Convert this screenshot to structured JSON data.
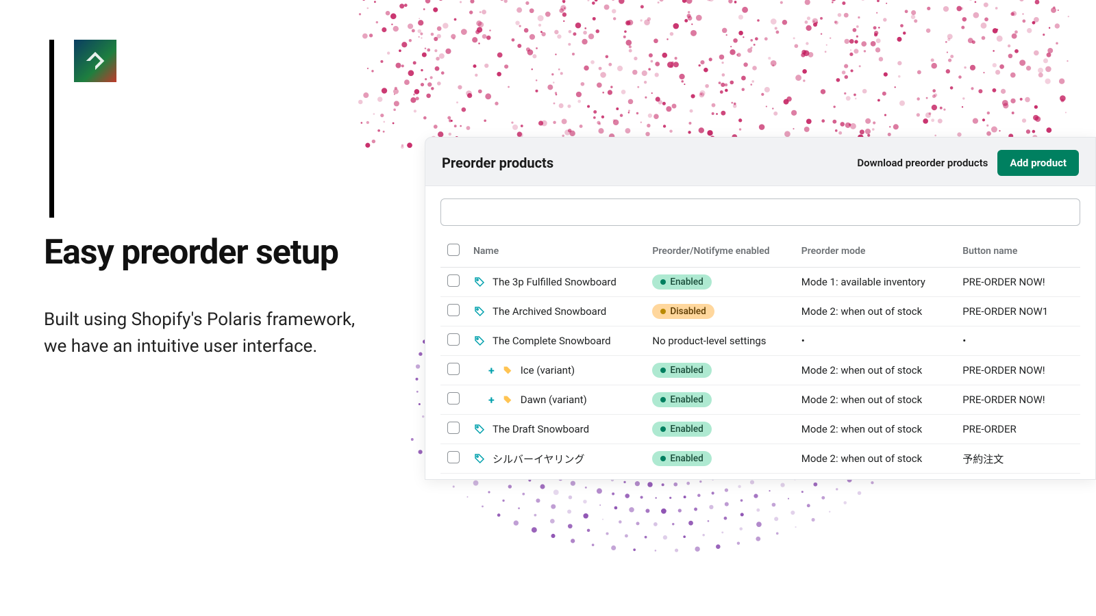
{
  "hero": {
    "title": "Easy preorder setup",
    "sub1": "Built using Shopify's Polaris framework,",
    "sub2": "we have an intuitive user interface."
  },
  "panel": {
    "title": "Preorder products",
    "download": "Download preorder products",
    "add": "Add product",
    "search_placeholder": ""
  },
  "columns": {
    "name": "Name",
    "status": "Preorder/Notifyme enabled",
    "mode": "Preorder mode",
    "button": "Button name"
  },
  "status_labels": {
    "enabled": "Enabled",
    "disabled": "Disabled",
    "none": "No product-level settings"
  },
  "rows": [
    {
      "name": "The 3p Fulfilled Snowboard",
      "icon": "tag-outline",
      "indent": false,
      "status": "enabled",
      "mode": "Mode 1: available inventory",
      "button": "PRE-ORDER NOW!"
    },
    {
      "name": "The Archived Snowboard",
      "icon": "tag-outline",
      "indent": false,
      "status": "disabled",
      "mode": "Mode 2: when out of stock",
      "button": "PRE-ORDER NOW1"
    },
    {
      "name": "The Complete Snowboard",
      "icon": "tag-outline",
      "indent": false,
      "status": "none",
      "mode": "•",
      "button": "•"
    },
    {
      "name": "Ice (variant)",
      "icon": "tag-solid",
      "indent": true,
      "status": "enabled",
      "mode": "Mode 2: when out of stock",
      "button": "PRE-ORDER NOW!"
    },
    {
      "name": "Dawn (variant)",
      "icon": "tag-solid",
      "indent": true,
      "status": "enabled",
      "mode": "Mode 2: when out of stock",
      "button": "PRE-ORDER NOW!"
    },
    {
      "name": "The Draft Snowboard",
      "icon": "tag-outline",
      "indent": false,
      "status": "enabled",
      "mode": "Mode 2: when out of stock",
      "button": "PRE-ORDER"
    },
    {
      "name": "シルバーイヤリング",
      "icon": "tag-outline",
      "indent": false,
      "status": "enabled",
      "mode": "Mode 2: when out of stock",
      "button": "予約注文"
    }
  ]
}
